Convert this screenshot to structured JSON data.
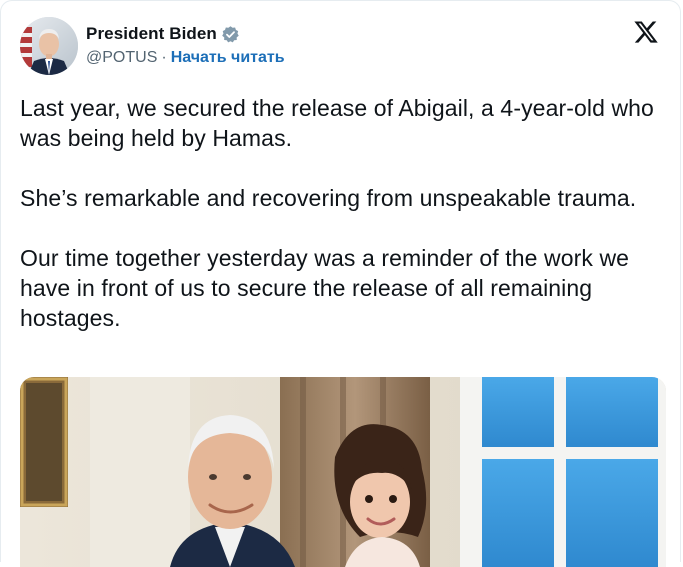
{
  "author": {
    "display_name": "President Biden",
    "handle": "@POTUS",
    "separator": "·",
    "follow_label": "Начать читать",
    "verified_color": "#829aab",
    "avatar_icon": "profile-photo"
  },
  "brand": {
    "logo_icon": "x-logo-icon"
  },
  "tweet": {
    "paragraphs": [
      "Last year, we secured the release of Abigail, a 4-year-old who was being held by Hamas.",
      "She’s remarkable and recovering from unspeakable trauma.",
      "Our time together yesterday was a reminder of the work we have in front of us to secure the release of all remaining hostages."
    ]
  },
  "media": {
    "kind": "photo"
  },
  "colors": {
    "text": "#0f1419",
    "secondary": "#536471",
    "link": "#1d6fb8",
    "border": "#e6ecf0"
  }
}
